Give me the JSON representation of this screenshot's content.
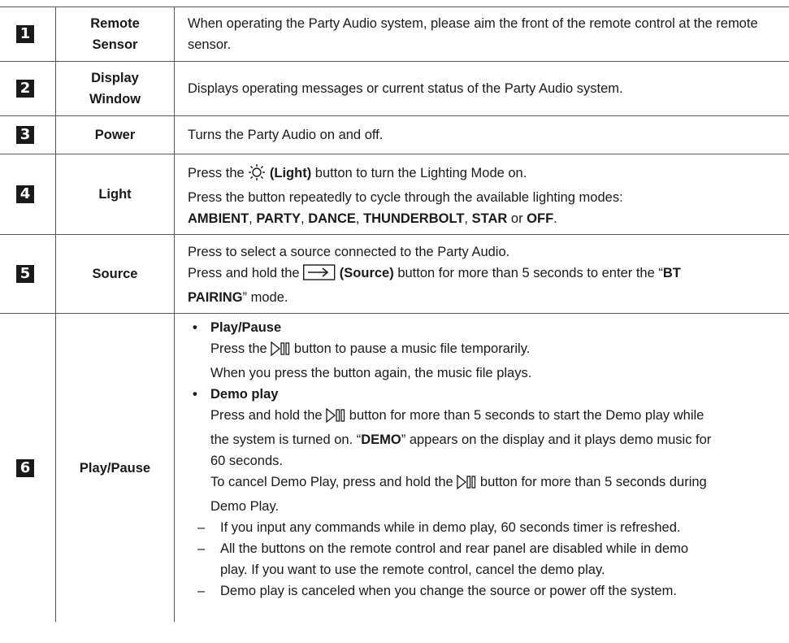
{
  "rows": [
    {
      "num": "1",
      "name_lines": [
        "Remote",
        "Sensor"
      ],
      "desc": "When operating the Party Audio system, please aim the front of the remote control at the remote sensor."
    },
    {
      "num": "2",
      "name_lines": [
        "Display",
        "Window"
      ],
      "desc": "Displays operating messages or current status of the Party Audio system."
    },
    {
      "num": "3",
      "name": "Power",
      "desc": "Turns the Party Audio on and off."
    },
    {
      "num": "4",
      "name": "Light",
      "line1_pre": "Press the",
      "line1_bold": "(Light)",
      "line1_post": "button to turn the Lighting Mode on.",
      "line2": "Press the button repeatedly to cycle through the available lighting modes:",
      "modes": [
        "AMBIENT",
        "PARTY",
        "DANCE",
        "THUNDERBOLT",
        "STAR"
      ],
      "modes_or": "or",
      "mode_off": "OFF"
    },
    {
      "num": "5",
      "name": "Source",
      "line1": "Press to select a source connected to the Party Audio.",
      "line2_pre": "Press and hold the",
      "line2_bold": "(Source)",
      "line2_post": "button for more than 5 seconds to enter the “",
      "bt1": "BT",
      "bt2": "PAIRING",
      "line3_post": "” mode."
    },
    {
      "num": "6",
      "name": "Play/Pause",
      "b1_title": "Play/Pause",
      "b1_l1_pre": "Press the",
      "b1_l1_post": "button to pause a music file temporarily.",
      "b1_l2": "When you press the button again, the music file plays.",
      "b2_title": "Demo play",
      "b2_l1_pre": "Press and hold the",
      "b2_l1_post": "button for more than 5 seconds to start the Demo play while",
      "b2_l2_pre": "the system is turned on. “",
      "b2_l2_bold": "DEMO",
      "b2_l2_post": "” appears on the display and it plays demo music for",
      "b2_l3": "60 seconds.",
      "b2_l4_pre": "To cancel Demo Play, press and hold the",
      "b2_l4_post": "button for more than 5 seconds during",
      "b2_l5": "Demo Play.",
      "notes": [
        "If you input any commands while in demo play, 60 seconds timer is refreshed.",
        "All the buttons on the remote control and rear panel are disabled while in demo",
        "play. If you want to use the remote control, cancel the demo play.",
        "Demo play is canceled when you change the source or power off the system."
      ]
    }
  ],
  "icons": {
    "light": "sun-icon",
    "source": "source-arrow-icon",
    "play_pause": "play-pause-icon"
  },
  "colors": {
    "text": "#1a1a1a",
    "badge": "#1a1a1a",
    "rule": "#555555"
  }
}
